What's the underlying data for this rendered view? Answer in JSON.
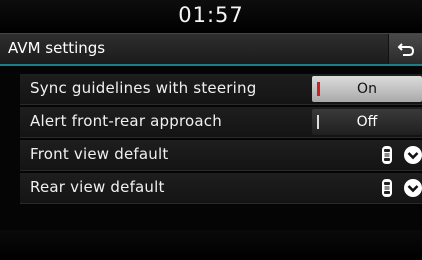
{
  "status": {
    "time": "01:57"
  },
  "header": {
    "title": "AVM settings",
    "back_icon": "back-arrow-icon"
  },
  "settings": [
    {
      "label": "Sync guidelines with steering",
      "control": "toggle",
      "value": "On",
      "state": "on"
    },
    {
      "label": "Alert front-rear approach",
      "control": "toggle",
      "value": "Off",
      "state": "off"
    },
    {
      "label": "Front view default",
      "control": "dropdown",
      "icon": "car-icon"
    },
    {
      "label": "Rear view default",
      "control": "dropdown",
      "icon": "car-icon"
    }
  ],
  "colors": {
    "accent_line": "#1a7f86",
    "on_indicator": "#d02020",
    "toggle_on_bg": "#c8c8c8",
    "toggle_off_bg": "#2a2a2a"
  }
}
